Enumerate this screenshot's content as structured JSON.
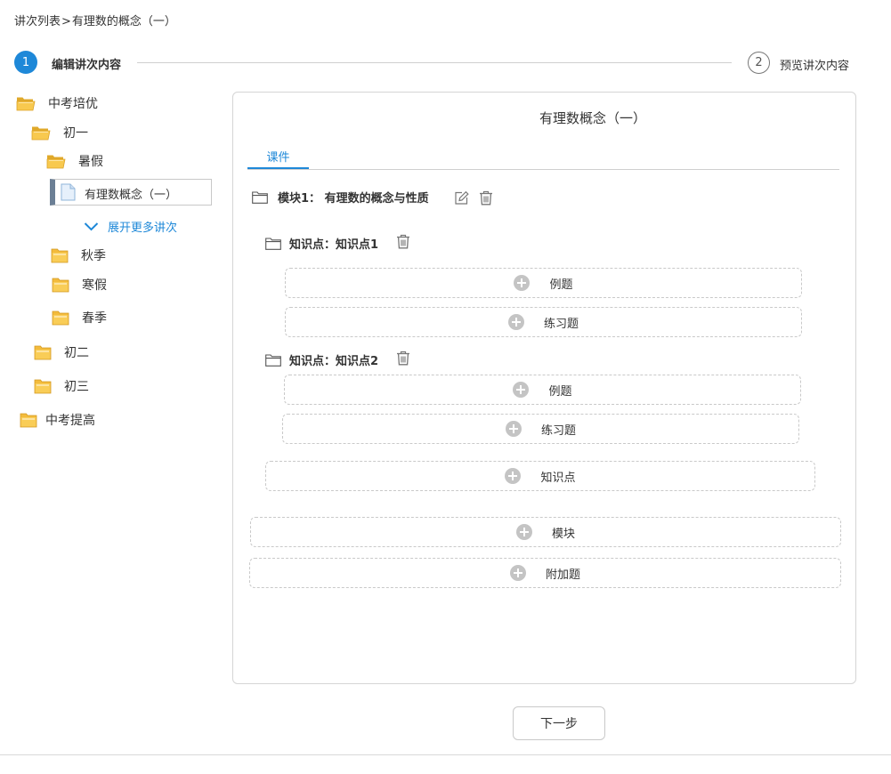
{
  "breadcrumb": {
    "root": "讲次列表",
    "separator": ">",
    "current": "有理数的概念（一）"
  },
  "steps": [
    {
      "number": "1",
      "label": "编辑讲次内容"
    },
    {
      "number": "2",
      "label": "预览讲次内容"
    }
  ],
  "tree": {
    "zhongkao_peiyou": "中考培优",
    "chuyi": "初一",
    "shujia": "暑假",
    "selected_lesson": "有理数概念（一）",
    "expand_more": "展开更多讲次",
    "qiuji": "秋季",
    "hanjia": "寒假",
    "chunji": "春季",
    "chuer": "初二",
    "chusan": "初三",
    "zhongkao_tigao": "中考提高"
  },
  "panel": {
    "title": "有理数概念（一）",
    "tab": "课件",
    "module_label": "模块1： 有理数的概念与性质",
    "knowledge_points": [
      {
        "label": "知识点：知识点1",
        "add_example": "例题",
        "add_exercise": "练习题"
      },
      {
        "label": "知识点：知识点2",
        "add_example": "例题",
        "add_exercise": "练习题"
      }
    ],
    "add_knowledge_point": "知识点",
    "add_module": "模块",
    "add_extra": "附加题"
  },
  "next_button": "下一步",
  "colors": {
    "accent": "#1e88d8",
    "folder": "#f7c54a",
    "selected_bar": "#6b7f95"
  }
}
